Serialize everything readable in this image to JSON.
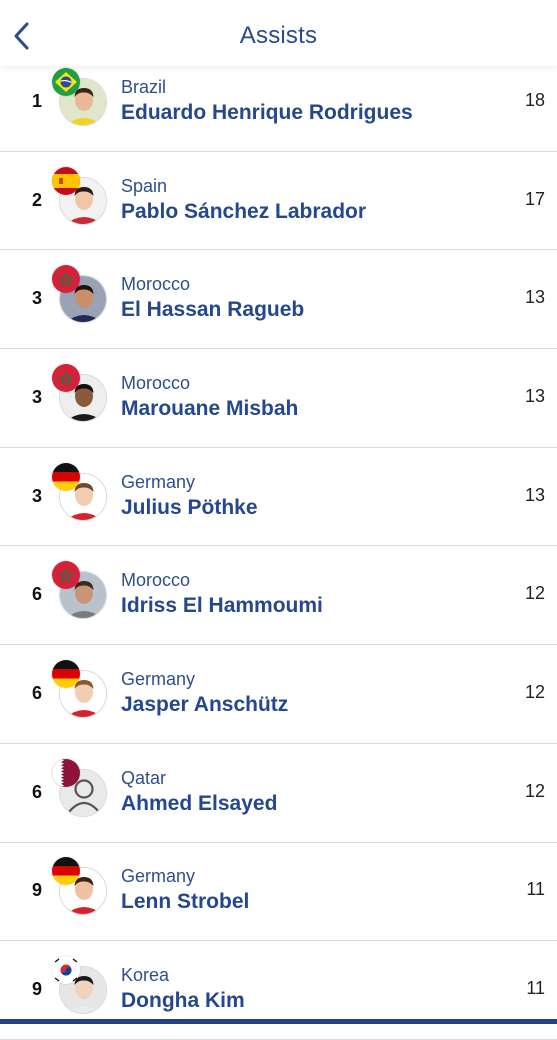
{
  "header": {
    "title": "Assists",
    "back_icon": "chevron-left-icon"
  },
  "colors": {
    "brand": "#24478f",
    "divider": "#dcdcdc"
  },
  "players": [
    {
      "rank": "1",
      "country": "Brazil",
      "name": "Eduardo Henrique Rodrigues",
      "assists": "18",
      "flag": "brazil"
    },
    {
      "rank": "2",
      "country": "Spain",
      "name": "Pablo Sánchez Labrador",
      "assists": "17",
      "flag": "spain"
    },
    {
      "rank": "3",
      "country": "Morocco",
      "name": "El Hassan Ragueb",
      "assists": "13",
      "flag": "morocco"
    },
    {
      "rank": "3",
      "country": "Morocco",
      "name": "Marouane Misbah",
      "assists": "13",
      "flag": "morocco"
    },
    {
      "rank": "3",
      "country": "Germany",
      "name": "Julius Pöthke",
      "assists": "13",
      "flag": "germany"
    },
    {
      "rank": "6",
      "country": "Morocco",
      "name": "Idriss El Hammoumi",
      "assists": "12",
      "flag": "morocco"
    },
    {
      "rank": "6",
      "country": "Germany",
      "name": "Jasper Anschütz",
      "assists": "12",
      "flag": "germany"
    },
    {
      "rank": "6",
      "country": "Qatar",
      "name": "Ahmed Elsayed",
      "assists": "12",
      "flag": "qatar"
    },
    {
      "rank": "9",
      "country": "Germany",
      "name": "Lenn Strobel",
      "assists": "11",
      "flag": "germany"
    },
    {
      "rank": "9",
      "country": "Korea",
      "name": "Dongha Kim",
      "assists": "11",
      "flag": "korea"
    }
  ]
}
